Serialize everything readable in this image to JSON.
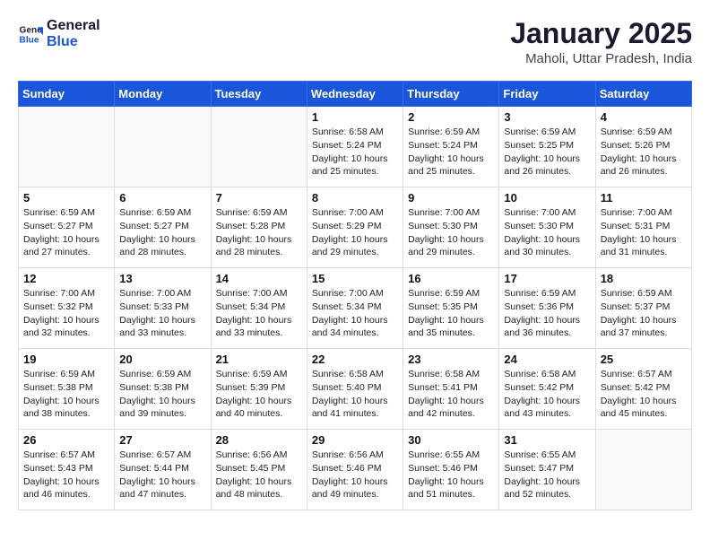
{
  "header": {
    "logo_line1": "General",
    "logo_line2": "Blue",
    "month": "January 2025",
    "location": "Maholi, Uttar Pradesh, India"
  },
  "days_of_week": [
    "Sunday",
    "Monday",
    "Tuesday",
    "Wednesday",
    "Thursday",
    "Friday",
    "Saturday"
  ],
  "weeks": [
    [
      {
        "day": "",
        "lines": []
      },
      {
        "day": "",
        "lines": []
      },
      {
        "day": "",
        "lines": []
      },
      {
        "day": "1",
        "lines": [
          "Sunrise: 6:58 AM",
          "Sunset: 5:24 PM",
          "Daylight: 10 hours",
          "and 25 minutes."
        ]
      },
      {
        "day": "2",
        "lines": [
          "Sunrise: 6:59 AM",
          "Sunset: 5:24 PM",
          "Daylight: 10 hours",
          "and 25 minutes."
        ]
      },
      {
        "day": "3",
        "lines": [
          "Sunrise: 6:59 AM",
          "Sunset: 5:25 PM",
          "Daylight: 10 hours",
          "and 26 minutes."
        ]
      },
      {
        "day": "4",
        "lines": [
          "Sunrise: 6:59 AM",
          "Sunset: 5:26 PM",
          "Daylight: 10 hours",
          "and 26 minutes."
        ]
      }
    ],
    [
      {
        "day": "5",
        "lines": [
          "Sunrise: 6:59 AM",
          "Sunset: 5:27 PM",
          "Daylight: 10 hours",
          "and 27 minutes."
        ]
      },
      {
        "day": "6",
        "lines": [
          "Sunrise: 6:59 AM",
          "Sunset: 5:27 PM",
          "Daylight: 10 hours",
          "and 28 minutes."
        ]
      },
      {
        "day": "7",
        "lines": [
          "Sunrise: 6:59 AM",
          "Sunset: 5:28 PM",
          "Daylight: 10 hours",
          "and 28 minutes."
        ]
      },
      {
        "day": "8",
        "lines": [
          "Sunrise: 7:00 AM",
          "Sunset: 5:29 PM",
          "Daylight: 10 hours",
          "and 29 minutes."
        ]
      },
      {
        "day": "9",
        "lines": [
          "Sunrise: 7:00 AM",
          "Sunset: 5:30 PM",
          "Daylight: 10 hours",
          "and 29 minutes."
        ]
      },
      {
        "day": "10",
        "lines": [
          "Sunrise: 7:00 AM",
          "Sunset: 5:30 PM",
          "Daylight: 10 hours",
          "and 30 minutes."
        ]
      },
      {
        "day": "11",
        "lines": [
          "Sunrise: 7:00 AM",
          "Sunset: 5:31 PM",
          "Daylight: 10 hours",
          "and 31 minutes."
        ]
      }
    ],
    [
      {
        "day": "12",
        "lines": [
          "Sunrise: 7:00 AM",
          "Sunset: 5:32 PM",
          "Daylight: 10 hours",
          "and 32 minutes."
        ]
      },
      {
        "day": "13",
        "lines": [
          "Sunrise: 7:00 AM",
          "Sunset: 5:33 PM",
          "Daylight: 10 hours",
          "and 33 minutes."
        ]
      },
      {
        "day": "14",
        "lines": [
          "Sunrise: 7:00 AM",
          "Sunset: 5:34 PM",
          "Daylight: 10 hours",
          "and 33 minutes."
        ]
      },
      {
        "day": "15",
        "lines": [
          "Sunrise: 7:00 AM",
          "Sunset: 5:34 PM",
          "Daylight: 10 hours",
          "and 34 minutes."
        ]
      },
      {
        "day": "16",
        "lines": [
          "Sunrise: 6:59 AM",
          "Sunset: 5:35 PM",
          "Daylight: 10 hours",
          "and 35 minutes."
        ]
      },
      {
        "day": "17",
        "lines": [
          "Sunrise: 6:59 AM",
          "Sunset: 5:36 PM",
          "Daylight: 10 hours",
          "and 36 minutes."
        ]
      },
      {
        "day": "18",
        "lines": [
          "Sunrise: 6:59 AM",
          "Sunset: 5:37 PM",
          "Daylight: 10 hours",
          "and 37 minutes."
        ]
      }
    ],
    [
      {
        "day": "19",
        "lines": [
          "Sunrise: 6:59 AM",
          "Sunset: 5:38 PM",
          "Daylight: 10 hours",
          "and 38 minutes."
        ]
      },
      {
        "day": "20",
        "lines": [
          "Sunrise: 6:59 AM",
          "Sunset: 5:38 PM",
          "Daylight: 10 hours",
          "and 39 minutes."
        ]
      },
      {
        "day": "21",
        "lines": [
          "Sunrise: 6:59 AM",
          "Sunset: 5:39 PM",
          "Daylight: 10 hours",
          "and 40 minutes."
        ]
      },
      {
        "day": "22",
        "lines": [
          "Sunrise: 6:58 AM",
          "Sunset: 5:40 PM",
          "Daylight: 10 hours",
          "and 41 minutes."
        ]
      },
      {
        "day": "23",
        "lines": [
          "Sunrise: 6:58 AM",
          "Sunset: 5:41 PM",
          "Daylight: 10 hours",
          "and 42 minutes."
        ]
      },
      {
        "day": "24",
        "lines": [
          "Sunrise: 6:58 AM",
          "Sunset: 5:42 PM",
          "Daylight: 10 hours",
          "and 43 minutes."
        ]
      },
      {
        "day": "25",
        "lines": [
          "Sunrise: 6:57 AM",
          "Sunset: 5:42 PM",
          "Daylight: 10 hours",
          "and 45 minutes."
        ]
      }
    ],
    [
      {
        "day": "26",
        "lines": [
          "Sunrise: 6:57 AM",
          "Sunset: 5:43 PM",
          "Daylight: 10 hours",
          "and 46 minutes."
        ]
      },
      {
        "day": "27",
        "lines": [
          "Sunrise: 6:57 AM",
          "Sunset: 5:44 PM",
          "Daylight: 10 hours",
          "and 47 minutes."
        ]
      },
      {
        "day": "28",
        "lines": [
          "Sunrise: 6:56 AM",
          "Sunset: 5:45 PM",
          "Daylight: 10 hours",
          "and 48 minutes."
        ]
      },
      {
        "day": "29",
        "lines": [
          "Sunrise: 6:56 AM",
          "Sunset: 5:46 PM",
          "Daylight: 10 hours",
          "and 49 minutes."
        ]
      },
      {
        "day": "30",
        "lines": [
          "Sunrise: 6:55 AM",
          "Sunset: 5:46 PM",
          "Daylight: 10 hours",
          "and 51 minutes."
        ]
      },
      {
        "day": "31",
        "lines": [
          "Sunrise: 6:55 AM",
          "Sunset: 5:47 PM",
          "Daylight: 10 hours",
          "and 52 minutes."
        ]
      },
      {
        "day": "",
        "lines": []
      }
    ]
  ]
}
